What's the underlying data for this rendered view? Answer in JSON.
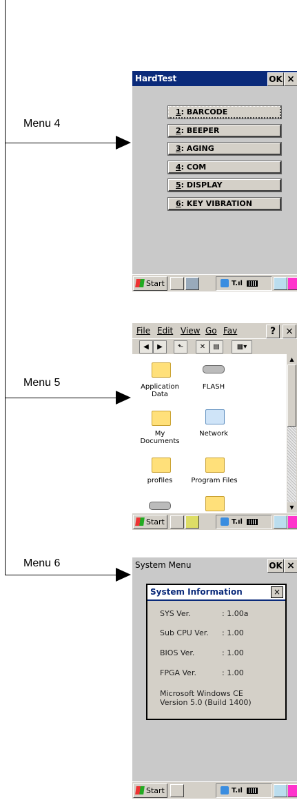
{
  "menus": [
    {
      "label": "Menu 4"
    },
    {
      "label": "Menu 5"
    },
    {
      "label": "Menu 6"
    }
  ],
  "hardtest": {
    "title": "HardTest",
    "ok": "OK",
    "close": "×",
    "buttons": [
      {
        "key": "1",
        "text": ": BARCODE"
      },
      {
        "key": "2",
        "text": ": BEEPER"
      },
      {
        "key": "3",
        "text": ": AGING"
      },
      {
        "key": "4",
        "text": ": COM"
      },
      {
        "key": "5",
        "text": ": DISPLAY"
      },
      {
        "key": "6",
        "text": ": KEY VIBRATION"
      }
    ]
  },
  "explorer": {
    "menu": [
      "File",
      "Edit",
      "View",
      "Go",
      "Fav"
    ],
    "help": "?",
    "close": "×",
    "items": [
      {
        "name": "Application\nData",
        "kind": "folder"
      },
      {
        "name": "FLASH",
        "kind": "drive"
      },
      {
        "name": "My\nDocuments",
        "kind": "folder"
      },
      {
        "name": "Network",
        "kind": "network"
      },
      {
        "name": "profiles",
        "kind": "folder"
      },
      {
        "name": "Program Files",
        "kind": "folder"
      },
      {
        "name": "",
        "kind": "drive"
      },
      {
        "name": "",
        "kind": "folder"
      }
    ]
  },
  "sysmenu": {
    "title": "System Menu",
    "ok": "OK",
    "close": "×",
    "dialog": {
      "title": "System Information",
      "close": "×",
      "rows": [
        {
          "label": "SYS Ver.",
          "value": ": 1.00a"
        },
        {
          "label": "Sub CPU Ver.",
          "value": ": 1.00"
        },
        {
          "label": "BIOS Ver.",
          "value": ": 1.00"
        },
        {
          "label": "FPGA Ver.",
          "value": ": 1.00"
        }
      ],
      "os_line1": "Microsoft Windows CE",
      "os_line2": "Version 5.0 (Build 1400)"
    }
  },
  "taskbar": {
    "start": "Start"
  }
}
